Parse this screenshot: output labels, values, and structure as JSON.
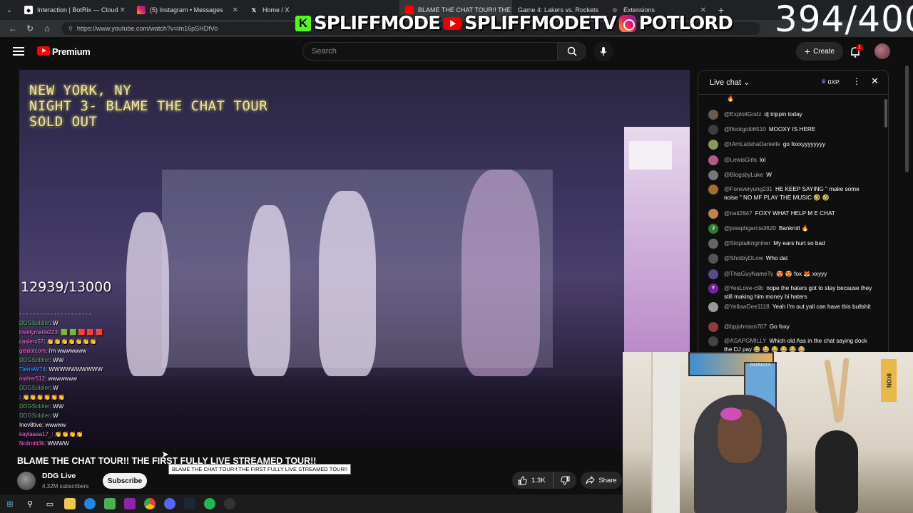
{
  "browser": {
    "tabs": [
      {
        "label": "Interaction | BotRix — Cloud",
        "icon": "botrix-icon",
        "color": "#ffffff"
      },
      {
        "label": "(5) Instagram • Messages",
        "icon": "instagram-icon",
        "color": "#e1306c"
      },
      {
        "label": "Home / X",
        "icon": "x-icon",
        "color": "#ffffff"
      },
      {
        "label": "BLAME THE CHAT TOUR!! THE",
        "icon": "youtube-icon",
        "color": "#ff0000"
      },
      {
        "label": "Game 4: Lakers vs. Rockets",
        "icon": "game-icon",
        "color": "#888888"
      },
      {
        "label": "Extensions",
        "icon": "extensions-icon",
        "color": "#aaaaaa"
      }
    ],
    "url": "https://www.youtube.com/watch?v=lm16pSHDfVo"
  },
  "overlay": {
    "kick_name": "SPLIFFMODE",
    "youtube_name": "SPLIFFMODETV",
    "instagram_name": "POTLORD",
    "top_counter": "394/400"
  },
  "header": {
    "brand": "Premium",
    "search_placeholder": "Search",
    "create_label": "Create",
    "notification_count": "1"
  },
  "video": {
    "venue_lines": [
      "NEW YORK, NY",
      "NIGHT 3- BLAME THE CHAT TOUR",
      "SOLD OUT"
    ],
    "goal_counter": "12939/13000",
    "stream_chat": [
      {
        "user": "DDGSoldier",
        "text": "W",
        "color": "#3fbf3f"
      },
      {
        "user": "lovelymarie223",
        "text": "🟩 🟩 🟥 🟥 🟥",
        "color": "#ff6fd8"
      },
      {
        "user": "casierx57",
        "text": "👏👏👏👏👏👏👏",
        "color": "#ff6fd8"
      },
      {
        "user": "geldotcom",
        "text": "i'm wwwwwww",
        "color": "#ff6fd8"
      },
      {
        "user": "DDGSoldier",
        "text": "WW",
        "color": "#3fbf3f"
      },
      {
        "user": "TierraW74",
        "text": "WWWWWWWWWW",
        "color": "#33aaff"
      },
      {
        "user": "maher512",
        "text": "wwwwwww",
        "color": "#ff6fd8"
      },
      {
        "user": "DDGSoldier",
        "text": "W",
        "color": "#3fbf3f"
      },
      {
        "user": "",
        "text": "👏👏👏👏👏👏",
        "color": "#ff3333"
      },
      {
        "user": "DDGSoldier",
        "text": "WW",
        "color": "#3fbf3f"
      },
      {
        "user": "DDGSoldier",
        "text": "W",
        "color": "#3fbf3f"
      },
      {
        "user": "Inov8tive",
        "text": "wwwww",
        "color": "#ffffff"
      },
      {
        "user": "kaylaaaa17_",
        "text": "👏👏👏👏",
        "color": "#ff6fd8"
      },
      {
        "user": "Nolimitt3k",
        "text": "WWWW",
        "color": "#ff6fd8"
      }
    ],
    "title": "BLAME THE CHAT TOUR!! THE FIRST FULLY LIVE STREAMED TOUR!!",
    "tooltip": "BLAME THE CHAT TOUR!! THE FIRST FULLY LIVE STREAMED TOUR!!",
    "channel_name": "DDG Live",
    "subscribers": "4.32M subscribers",
    "subscribe_label": "Subscribe",
    "likes": "1.3K",
    "share_label": "Share"
  },
  "live_chat": {
    "title": "Live chat",
    "xp": "0XP",
    "messages": [
      {
        "author": "",
        "text": "🔥",
        "avatar_color": "#ff6a00"
      },
      {
        "author": "@ExploitGodz",
        "text": "dj trippin today",
        "avatar_color": "#6b5b4f"
      },
      {
        "author": "@flockgotti6510",
        "text": "MOOXY IS HERE",
        "avatar_color": "#3d3d3d"
      },
      {
        "author": "@IAmLatishaDanielle",
        "text": "go foxxyyyyyyyy",
        "avatar_color": "#8a9a5b"
      },
      {
        "author": "@LewisGirls",
        "text": "lol",
        "avatar_color": "#b45a8c"
      },
      {
        "author": "@BlogsbyLuke",
        "text": "W",
        "avatar_color": "#777777"
      },
      {
        "author": "@Foreveryung231",
        "text": "HE KEEP SAYING \" make some noise \" NO MF PLAY THE MUSIC 🤣 🤣",
        "avatar_color": "#a07030"
      },
      {
        "author": "@nati2947",
        "text": "FOXY WHAT HELP M E CHAT",
        "avatar_color": "#c08050"
      },
      {
        "author": "@josephgarcia3620",
        "text": "Bankroll 🔥",
        "avatar_color": "#2e7d32",
        "initial": "J"
      },
      {
        "author": "@Stoptalkngniner",
        "text": "My ears hurt so bad",
        "avatar_color": "#666666"
      },
      {
        "author": "@ShotbyDLow",
        "text": "Who dat",
        "avatar_color": "#555555"
      },
      {
        "author": "@ThisGuyNameTy",
        "text": "😍 😍 fox 🦊 xxyyy",
        "avatar_color": "#5a4a8a"
      },
      {
        "author": "@YesLove-c9b",
        "text": "nope the haters got to stay because they still making him money hi haters",
        "avatar_color": "#7b1fa2",
        "initial": "Y"
      },
      {
        "author": "@YellowDee1118",
        "text": "Yeah I'm out yall can have this bullshit",
        "avatar_color": "#999999"
      },
      {
        "author": "@bpjohnson707",
        "text": "Go foxy",
        "avatar_color": "#8d3b3b"
      },
      {
        "author": "@ASAPGMILLY",
        "text": "Which old Ass in the chat saying dock the DJ pay 😂 😂 😂 😂 😂 😂",
        "avatar_color": "#444444"
      }
    ]
  },
  "webcam": {
    "poster_label": "PATRIOTS",
    "banner_label": "IKON"
  }
}
